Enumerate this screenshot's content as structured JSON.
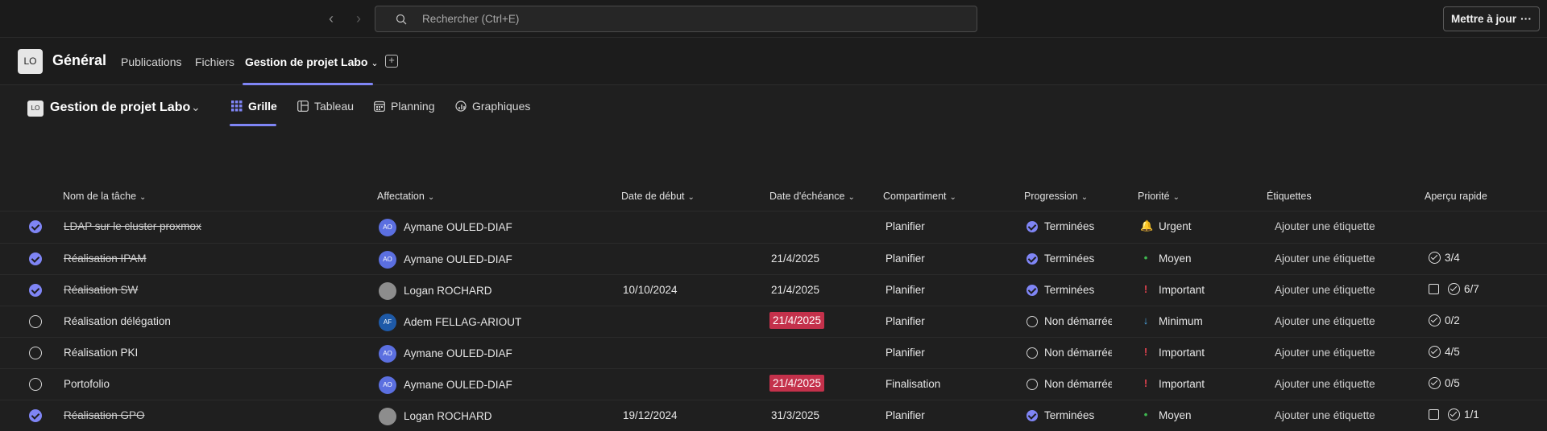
{
  "topbar": {
    "search_placeholder": "Rechercher (Ctrl+E)",
    "update_button": "Mettre à jour",
    "more_glyph": "···"
  },
  "channel": {
    "avatar_initials": "LO",
    "title": "Général",
    "tabs": [
      {
        "label": "Publications"
      },
      {
        "label": "Fichiers"
      },
      {
        "label": "Gestion de projet Labo",
        "active": true
      }
    ]
  },
  "plan": {
    "avatar_initials": "LO",
    "title": "Gestion de projet Labo",
    "views": [
      {
        "label": "Grille",
        "active": true,
        "icon": "grid-icon"
      },
      {
        "label": "Tableau",
        "icon": "board-icon"
      },
      {
        "label": "Planning",
        "icon": "calendar-icon"
      },
      {
        "label": "Graphiques",
        "icon": "chart-icon"
      }
    ]
  },
  "columns": {
    "task": "Nom de la tâche",
    "assign": "Affectation",
    "start": "Date de début",
    "due": "Date d'échéance",
    "bucket": "Compartiment",
    "progress": "Progression",
    "priority": "Priorité",
    "labels": "Étiquettes",
    "preview": "Aperçu rapide"
  },
  "colors": {
    "accent": "#7f85f5",
    "overdue": "#c4314b",
    "urgent": "#e97548",
    "important": "#e0424f",
    "medium": "#3fb950",
    "low": "#4aa3df"
  },
  "tasks": [
    {
      "name": "LDAP sur le cluster proxmox",
      "done": true,
      "assignee_initials": "AO",
      "assignee": "Aymane OULED-DIAF",
      "start": "",
      "due": "",
      "bucket": "Planifier",
      "progress": "Terminées",
      "priority": "Urgent",
      "priority_glyph": "🔔",
      "label": "Ajouter une étiquette",
      "checklist": ""
    },
    {
      "name": "Réalisation IPAM",
      "done": true,
      "assignee_initials": "AO",
      "assignee": "Aymane OULED-DIAF",
      "start": "",
      "due": "21/4/2025",
      "bucket": "Planifier",
      "progress": "Terminées",
      "priority": "Moyen",
      "priority_glyph": "•",
      "label": "Ajouter une étiquette",
      "checklist": "3/4"
    },
    {
      "name": "Réalisation SW",
      "done": true,
      "assignee_initials": "",
      "assignee": "Logan ROCHARD",
      "start": "10/10/2024",
      "due": "21/4/2025",
      "bucket": "Planifier",
      "progress": "Terminées",
      "priority": "Important",
      "priority_glyph": "!",
      "label": "Ajouter une étiquette",
      "checklist": "6/7",
      "note": true
    },
    {
      "name": "Réalisation délégation",
      "done": false,
      "assignee_initials": "AF",
      "assignee": "Adem FELLAG-ARIOUT",
      "start": "",
      "due": "21/4/2025",
      "overdue": true,
      "bucket": "Planifier",
      "progress": "Non démarrée",
      "priority": "Minimum",
      "priority_glyph": "↓",
      "label": "Ajouter une étiquette",
      "checklist": "0/2"
    },
    {
      "name": "Réalisation PKI",
      "done": false,
      "assignee_initials": "AO",
      "assignee": "Aymane OULED-DIAF",
      "start": "",
      "due": "",
      "bucket": "Planifier",
      "progress": "Non démarrée",
      "priority": "Important",
      "priority_glyph": "!",
      "label": "Ajouter une étiquette",
      "checklist": "4/5"
    },
    {
      "name": "Portofolio",
      "done": false,
      "assignee_initials": "AO",
      "assignee": "Aymane OULED-DIAF",
      "start": "",
      "due": "21/4/2025",
      "overdue": true,
      "bucket": "Finalisation",
      "progress": "Non démarrée",
      "priority": "Important",
      "priority_glyph": "!",
      "label": "Ajouter une étiquette",
      "checklist": "0/5"
    },
    {
      "name": "Réalisation GPO",
      "done": true,
      "assignee_initials": "",
      "assignee": "Logan ROCHARD",
      "start": "19/12/2024",
      "due": "31/3/2025",
      "bucket": "Planifier",
      "progress": "Terminées",
      "priority": "Moyen",
      "priority_glyph": "•",
      "label": "Ajouter une étiquette",
      "checklist": "1/1",
      "note": true
    }
  ]
}
